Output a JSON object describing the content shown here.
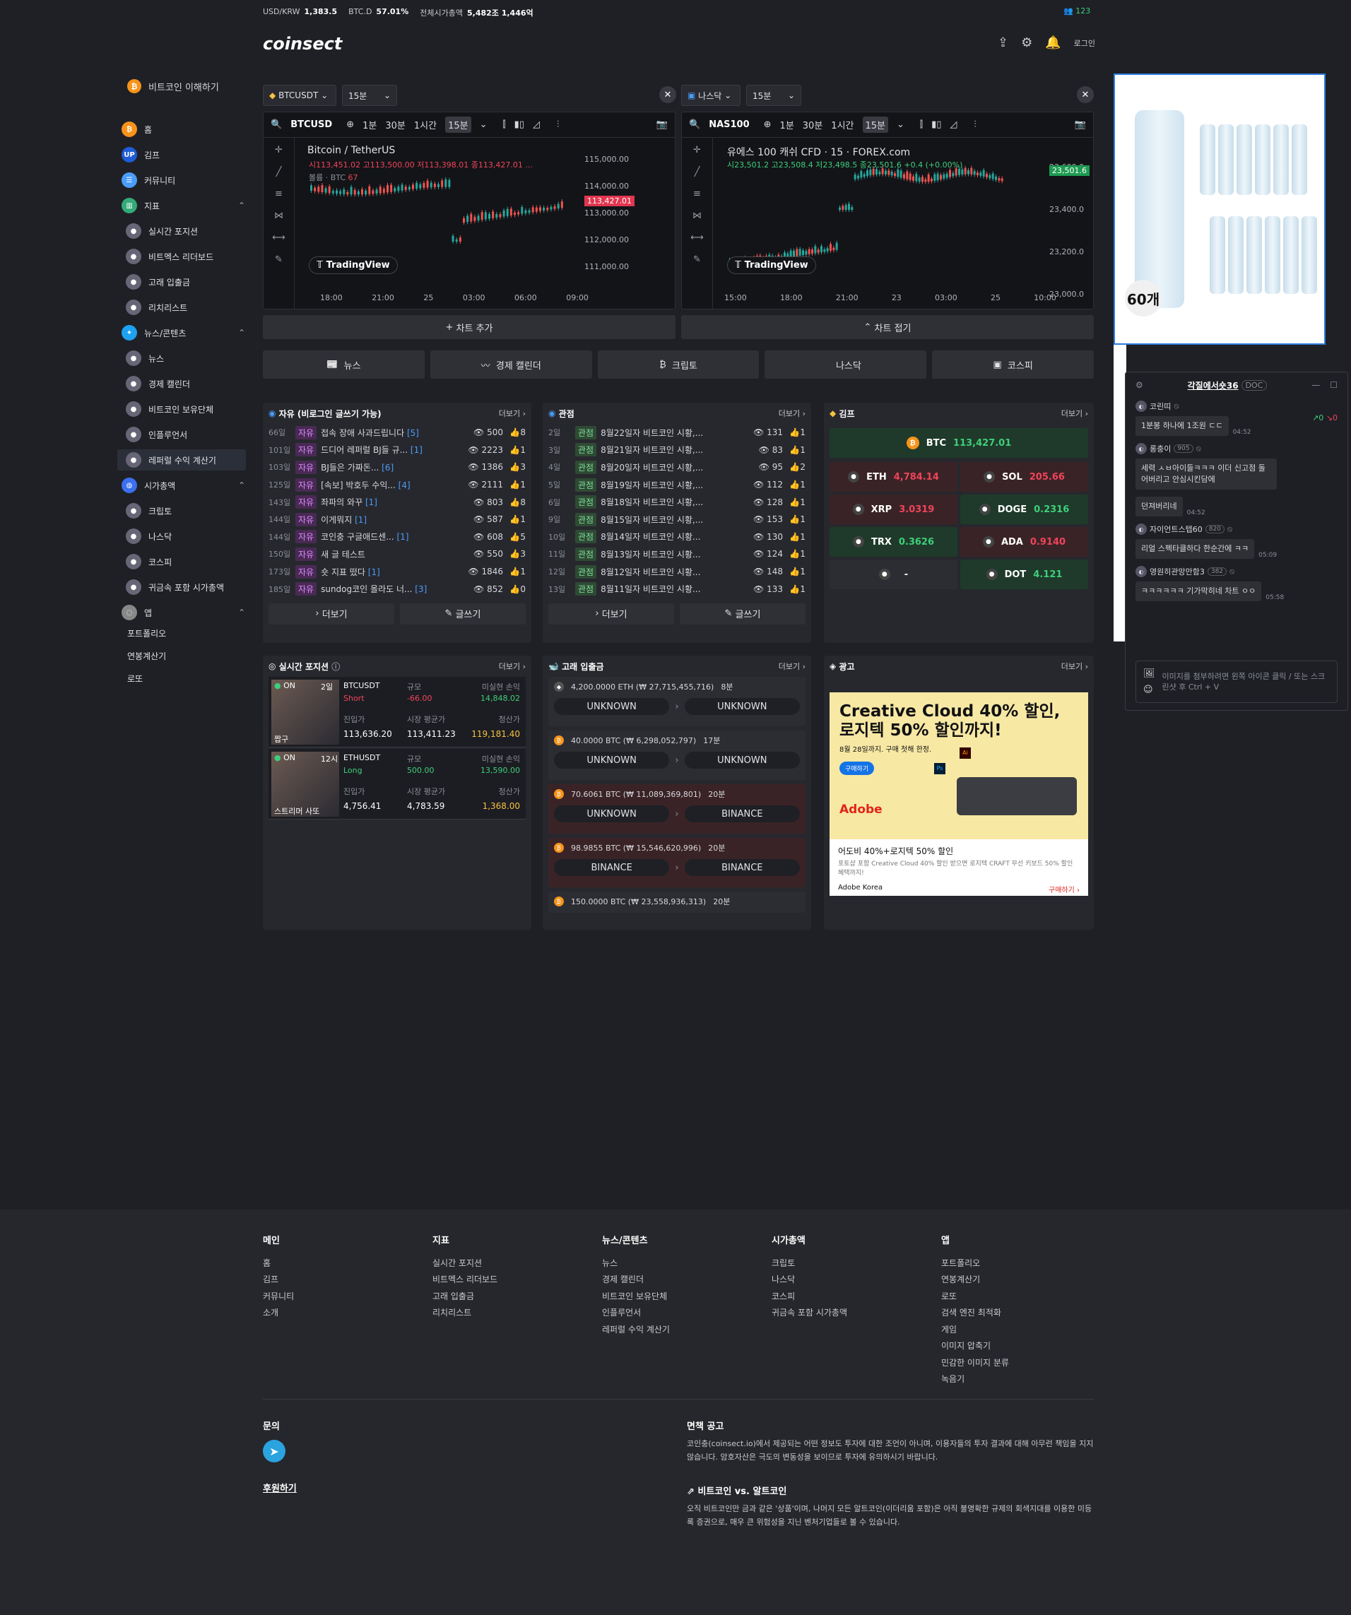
{
  "topbar": {
    "usdkrw_label": "USD/KRW",
    "usdkrw": "1,383.5",
    "btcd_label": "BTC.D",
    "btcd": "57.01%",
    "mcap_label": "전체시가총액",
    "mcap": "5,482조 1,446억",
    "online": "123"
  },
  "header": {
    "logo": "coinsect",
    "login": "로그인"
  },
  "sidebar": {
    "top": "비트코인 이해하기",
    "home": "홈",
    "kimp": "김프",
    "community": "커뮤니티",
    "indicator": "지표",
    "ind_items": [
      "실시간 포지션",
      "비트멕스 리더보드",
      "고래 입출금",
      "리치리스트"
    ],
    "news": "뉴스/콘텐츠",
    "news_items": [
      "뉴스",
      "경제 캘린더",
      "비트코인 보유단체",
      "인플루언서",
      "레퍼럴 수익 계산기"
    ],
    "mcap": "시가총액",
    "mcap_items": [
      "크립토",
      "나스닥",
      "코스피",
      "귀금속 포함 시가총액"
    ],
    "apps": "앱",
    "app_items": [
      "포트폴리오",
      "연봉계산기",
      "로또"
    ]
  },
  "left_chart": {
    "symbol_sel": "BTCUSDT",
    "interval_sel": "15분",
    "search": "BTCUSD",
    "tf": [
      "1분",
      "30분",
      "1시간",
      "15분"
    ],
    "title": "Bitcoin / TetherUS",
    "ohlc": "시113,451.02 고113,500.00 저113,398.01 종113,427.01 ...",
    "vol": "볼륨 · BTC",
    "vol_val": "67",
    "prices": [
      "115,000.00",
      "114,000.00",
      "113,000.00",
      "112,000.00",
      "111,000.00"
    ],
    "last": "113,427.01",
    "times": [
      "18:00",
      "21:00",
      "25",
      "03:00",
      "06:00",
      "09:00"
    ],
    "tv": "TradingView"
  },
  "right_chart": {
    "symbol_sel": "나스닥",
    "interval_sel": "15분",
    "search": "NAS100",
    "tf": [
      "1분",
      "30분",
      "1시간",
      "15분"
    ],
    "title": "유에스 100 캐쉬 CFD · 15 · FOREX.com",
    "ohlc": "시23,501.2 고23,508.4 저23,498.5 종23,501.6 +0.4 (+0.00%)",
    "prices": [
      "23,600.0",
      "23,400.0",
      "23,200.0",
      "23,000.0"
    ],
    "last": "23,501.6",
    "times": [
      "15:00",
      "18:00",
      "21:00",
      "23",
      "03:00",
      "25",
      "10:00"
    ],
    "tv": "TradingView"
  },
  "chart_add": "차트 추가",
  "chart_fold": "차트 접기",
  "tabs": [
    "뉴스",
    "경제 캘린더",
    "크립토",
    "나스닥",
    "코스피"
  ],
  "free_board": {
    "title": "자유 (비로그인 글쓰기 가능)",
    "more": "더보기",
    "tag": "자유",
    "rows": [
      {
        "no": "66일",
        "t": "접속 장애 사과드립니다",
        "c": "[5]",
        "v": "500",
        "l": "8"
      },
      {
        "no": "101일",
        "t": "드디어 레퍼럴 BJ들 규...",
        "c": "[1]",
        "v": "2223",
        "l": "1"
      },
      {
        "no": "103일",
        "t": "BJ들은 가짜돈...",
        "c": "[6]",
        "v": "1386",
        "l": "3"
      },
      {
        "no": "125일",
        "t": "[속보] 박호두 수익...",
        "c": "[4]",
        "v": "2111",
        "l": "1"
      },
      {
        "no": "143일",
        "t": "좌파의 와꾸",
        "c": "[1]",
        "v": "803",
        "l": "8"
      },
      {
        "no": "144일",
        "t": "이게뭐지",
        "c": "[1]",
        "v": "587",
        "l": "1"
      },
      {
        "no": "144일",
        "t": "코인충 구글애드센...",
        "c": "[1]",
        "v": "608",
        "l": "5"
      },
      {
        "no": "150일",
        "t": "새 글 테스트",
        "c": "",
        "v": "550",
        "l": "3"
      },
      {
        "no": "173일",
        "t": "숏 지표 떴다",
        "c": "[1]",
        "v": "1846",
        "l": "1"
      },
      {
        "no": "185일",
        "t": "sundog코인 올라도 너...",
        "c": "[3]",
        "v": "852",
        "l": "0"
      }
    ],
    "more_btn": "더보기",
    "write_btn": "글쓰기"
  },
  "view_board": {
    "title": "관점",
    "more": "더보기",
    "tag": "관점",
    "rows": [
      {
        "no": "2일",
        "t": "8월22일자 비트코인 시황,...",
        "v": "131",
        "l": "1"
      },
      {
        "no": "3일",
        "t": "8월21일자 비트코인 시황,...",
        "v": "83",
        "l": "1"
      },
      {
        "no": "4일",
        "t": "8월20일자 비트코인 시황,...",
        "v": "95",
        "l": "2"
      },
      {
        "no": "5일",
        "t": "8월19일자 비트코인 시황,...",
        "v": "112",
        "l": "1"
      },
      {
        "no": "6일",
        "t": "8월18일자 비트코인 시황,...",
        "v": "128",
        "l": "1"
      },
      {
        "no": "9일",
        "t": "8월15일자 비트코인 시황,...",
        "v": "153",
        "l": "1"
      },
      {
        "no": "10일",
        "t": "8월14일자 비트코인 시황...",
        "v": "130",
        "l": "1"
      },
      {
        "no": "11일",
        "t": "8월13일자 비트코인 시황...",
        "v": "124",
        "l": "1"
      },
      {
        "no": "12일",
        "t": "8월12일자 비트코인 시황...",
        "v": "148",
        "l": "1"
      },
      {
        "no": "13일",
        "t": "8월11일자 비트코인 시황...",
        "v": "133",
        "l": "1"
      }
    ],
    "more_btn": "더보기",
    "write_btn": "글쓰기"
  },
  "kimp": {
    "title": "김프",
    "more": "더보기",
    "btc": "BTC",
    "btc_v": "113,427.01",
    "coins": [
      {
        "n": "ETH",
        "v": "4,784.14",
        "c": "r"
      },
      {
        "n": "SOL",
        "v": "205.66",
        "c": "r"
      },
      {
        "n": "XRP",
        "v": "3.0319",
        "c": "r"
      },
      {
        "n": "DOGE",
        "v": "0.2316",
        "c": "g"
      },
      {
        "n": "TRX",
        "v": "0.3626",
        "c": "g"
      },
      {
        "n": "ADA",
        "v": "0.9140",
        "c": "r"
      },
      {
        "n": "",
        "v": "-",
        "c": "w"
      },
      {
        "n": "DOT",
        "v": "4.121",
        "c": "g"
      }
    ]
  },
  "positions": {
    "title": "실시간 포지션",
    "more": "더보기",
    "items": [
      {
        "on": "ON",
        "age": "2일",
        "sym": "BTCUSDT",
        "side": "Short",
        "size_l": "규모",
        "size": "-66.00",
        "pnl_l": "미실현 손익",
        "pnl": "14,848.02",
        "entry_l": "진입가",
        "entry": "113,636.20",
        "mark_l": "시장 평균가",
        "mark": "113,411.23",
        "liq_l": "청산가",
        "liq": "119,181.40",
        "name": "짭구"
      },
      {
        "on": "ON",
        "age": "12시",
        "sym": "ETHUSDT",
        "side": "Long",
        "size_l": "규모",
        "size": "500.00",
        "pnl_l": "미실현 손익",
        "pnl": "13,590.00",
        "entry_l": "진입가",
        "entry": "4,756.41",
        "mark_l": "시장 평균가",
        "mark": "4,783.59",
        "liq_l": "청산가",
        "liq": "1,368.00",
        "name": "스트리머 사또"
      }
    ]
  },
  "whale": {
    "title": "고래 입출금",
    "more": "더보기",
    "items": [
      {
        "amt": "4,200.0000 ETH (₩ 27,715,455,716)",
        "ago": "8분",
        "from": "UNKNOWN",
        "to": "UNKNOWN"
      },
      {
        "amt": "40.0000 BTC (₩ 6,298,052,797)",
        "ago": "17분",
        "from": "UNKNOWN",
        "to": "UNKNOWN"
      },
      {
        "amt": "70.6061 BTC (₩ 11,089,369,801)",
        "ago": "20분",
        "from": "UNKNOWN",
        "to": "BINANCE"
      },
      {
        "amt": "98.9855 BTC (₩ 15,546,620,996)",
        "ago": "20분",
        "from": "BINANCE",
        "to": "BINANCE"
      },
      {
        "amt": "150.0000 BTC (₩ 23,558,936,313)",
        "ago": "20분",
        "from": "",
        "to": ""
      }
    ]
  },
  "ad": {
    "title": "광고",
    "more": "더보기",
    "headline1": "Creative Cloud 40% 할인,",
    "headline2": "로지텍 50% 할인까지!",
    "sub": "8월 28일까지. 구매 첫해 한정.",
    "buy": "구매하기",
    "brand": "Adobe",
    "ad_title": "어도비 40%+로지텍 50% 할인",
    "ad_desc": "포토샵 포함 Creative Cloud 40% 할인 받으면 로지텍 CRAFT 무선 키보드 50% 할인 혜택까지!",
    "advertiser": "Adobe Korea",
    "cta": "구매하기"
  },
  "side_ad": {
    "badge": "60개"
  },
  "chat": {
    "title": "각질에서숏36",
    "doc": "DOC",
    "up": "0",
    "down": "0",
    "msgs": [
      {
        "user": "코린띠",
        "lvl": "",
        "text": "1분봉 하나에 1조원 ㄷㄷ",
        "time": "04:52"
      },
      {
        "user": "롱충이",
        "lvl": "905",
        "text": "세력 ㅅㅂ아이들ㅋㅋㅋ 이더 신고점 돌어버리고 안심시킨담에",
        "time": ""
      },
      {
        "user": "",
        "lvl": "",
        "text": "던져버리네",
        "time": "04:52"
      },
      {
        "user": "자이언트스텝60",
        "lvl": "820",
        "text": "리얼 스펙타클하다 한순간에 ㅋㅋ",
        "time": "05:09"
      },
      {
        "user": "영원히관망만함3",
        "lvl": "382",
        "text": "ㅋㅋㅋㅋㅋㅋ 기가막히네 차트 ㅇㅇ",
        "time": "05:58"
      }
    ],
    "input_ph": "이미지를 첨부하려면 왼쪽 아이콘 클릭 / 또는 스크린샷 후 Ctrl + V"
  },
  "footer": {
    "cols": [
      {
        "h": "메인",
        "items": [
          "홈",
          "김프",
          "커뮤니티",
          "소개"
        ]
      },
      {
        "h": "지표",
        "items": [
          "실시간 포지션",
          "비트멕스 리더보드",
          "고래 입출금",
          "리치리스트"
        ]
      },
      {
        "h": "뉴스/콘텐츠",
        "items": [
          "뉴스",
          "경제 캘린더",
          "비트코인 보유단체",
          "인플루언서",
          "레퍼럴 수익 계산기"
        ]
      },
      {
        "h": "시가총액",
        "items": [
          "크립토",
          "나스닥",
          "코스피",
          "귀금속 포함 시가총액"
        ]
      },
      {
        "h": "앱",
        "items": [
          "포트폴리오",
          "연봉계산기",
          "로또",
          "검색 엔진 최적화",
          "게임",
          "이미지 압축기",
          "민감한 이미지 분류",
          "녹음기"
        ]
      }
    ],
    "contact": "문의",
    "sponsor": "후원하기",
    "disc_h": "면책 공고",
    "disc": "코인충(coinsect.io)에서 제공되는 어떤 정보도 투자에 대한 조언이 아니며, 이용자들의 투자 결과에 대해 아무런 책임을 지지 않습니다. 암호자산은 극도의 변동성을 보이므로 투자에 유의하시기 바랍니다.",
    "btc_h": "비트코인 vs. 알트코인",
    "btc_t": "오직 비트코인만 금과 같은 '상품'이며, 나머지 모든 알트코인(이더리움 포함)은 아직 불명확한 규제의 회색지대를 이용한 미등록 증권으로, 매우 큰 위험성을 지닌 벤처기업들로 볼 수 있습니다."
  }
}
